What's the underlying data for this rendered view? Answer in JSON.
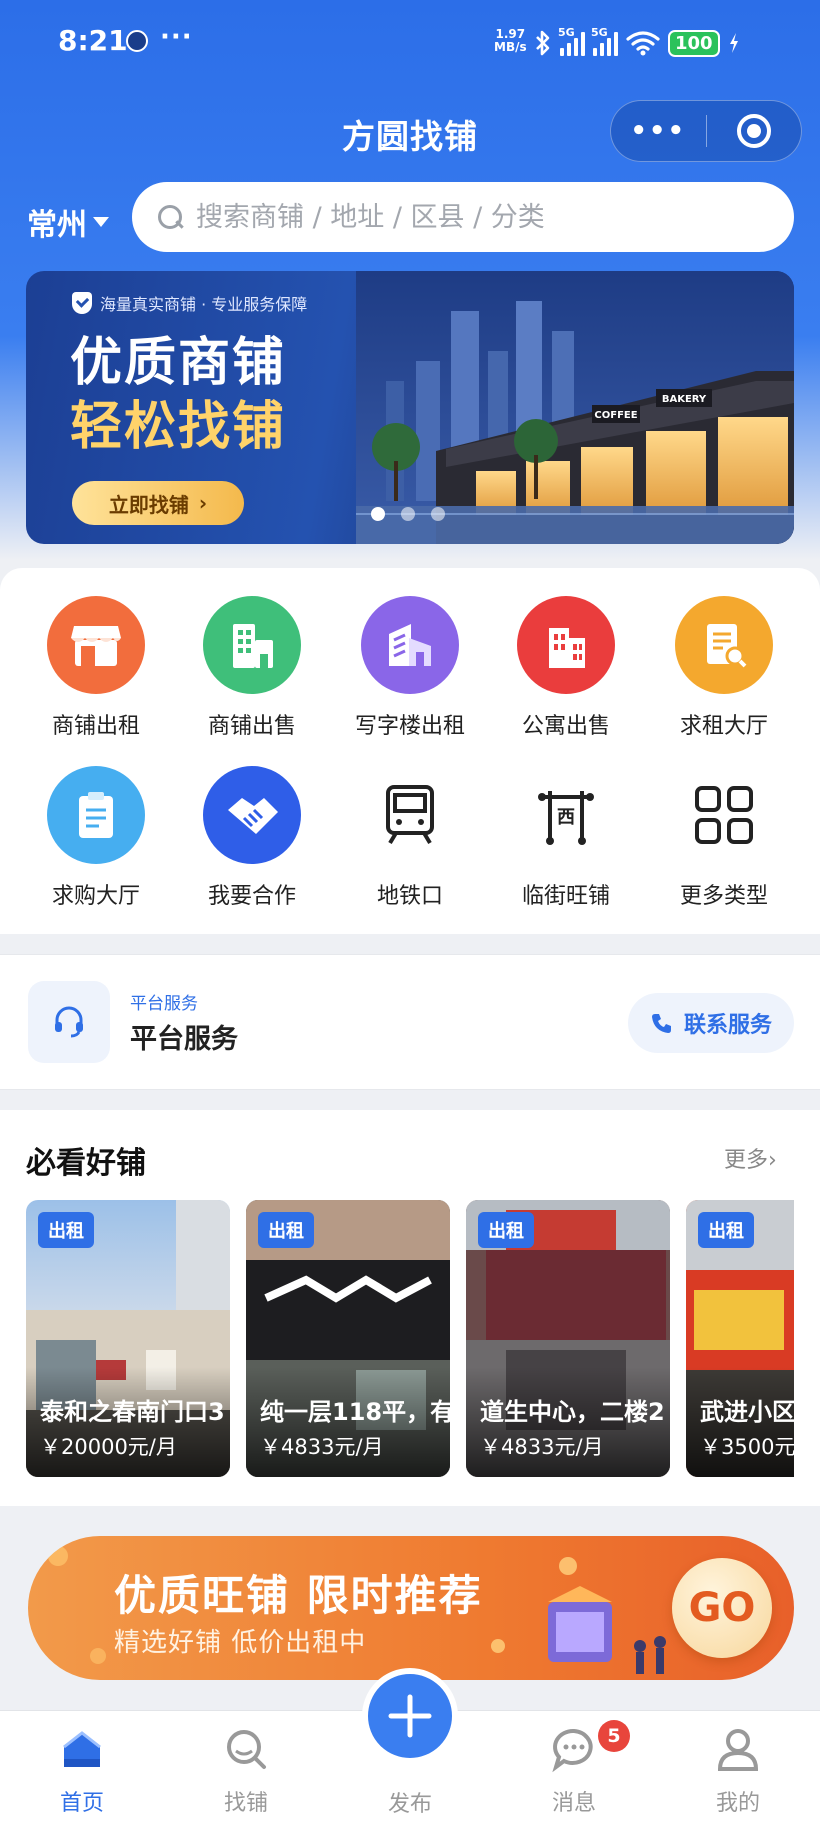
{
  "status_bar": {
    "time": "8:21",
    "more": "···",
    "speed_top": "1.97",
    "speed_bottom": "MB/s",
    "signal_tag_1": "5G",
    "signal_tag_2": "5G",
    "battery": "100"
  },
  "header": {
    "title": "方圆找铺",
    "capsule_more": "•••"
  },
  "search": {
    "city": "常州",
    "placeholder": "搜索商铺 / 地址 / 区县 / 分类"
  },
  "banner": {
    "tagline": "海量真实商铺 · 专业服务保障",
    "headline_1": "优质商铺",
    "headline_2": "轻松找铺",
    "button_label": "立即找铺",
    "button_arrow": "›",
    "slide_count": 3,
    "active_slide": 1,
    "storefront_sign_1": "COFFEE",
    "storefront_sign_2": "BAKERY"
  },
  "categories": [
    {
      "label": "商铺出租",
      "icon": "shop-icon",
      "color": "#f26d3d"
    },
    {
      "label": "商铺出售",
      "icon": "building-icon",
      "color": "#3fbf7a"
    },
    {
      "label": "写字楼出租",
      "icon": "office-icon",
      "color": "#8a66e8"
    },
    {
      "label": "公寓出售",
      "icon": "apartment-icon",
      "color": "#ea3d3d"
    },
    {
      "label": "求租大厅",
      "icon": "doc-search-icon",
      "color": "#f4a82e"
    },
    {
      "label": "求购大厅",
      "icon": "clipboard-icon",
      "color": "#46aef0"
    },
    {
      "label": "我要合作",
      "icon": "handshake-icon",
      "color": "#2f5ee8"
    },
    {
      "label": "地铁口",
      "icon": "subway-icon",
      "color": "#222222"
    },
    {
      "label": "临街旺铺",
      "icon": "street-shop-icon",
      "color": "#222222"
    },
    {
      "label": "更多类型",
      "icon": "grid-icon",
      "color": "#222222"
    }
  ],
  "service": {
    "small_label": "平台服务",
    "title": "平台服务",
    "button_label": "联系服务"
  },
  "hot": {
    "title": "必看好铺",
    "more": "更多",
    "more_arrow": "›",
    "items": [
      {
        "badge": "出租",
        "name": "泰和之春南门口3",
        "price": "￥20000元/月"
      },
      {
        "badge": "出租",
        "name": "纯一层118平，有",
        "price": "￥4833元/月"
      },
      {
        "badge": "出租",
        "name": "道生中心，二楼2",
        "price": "￥4833元/月"
      },
      {
        "badge": "出租",
        "name": "武进小区",
        "price": "￥3500元"
      }
    ]
  },
  "promo": {
    "headline": "优质旺铺 限时推荐",
    "subline": "精选好铺  低价出租中",
    "go": "GO"
  },
  "tabbar": {
    "home": "首页",
    "find": "找铺",
    "publish": "发布",
    "messages": "消息",
    "messages_badge": "5",
    "mine": "我的"
  },
  "colors": {
    "brand_blue": "#2f6fe6",
    "header_blue": "#2c6ee8",
    "promo_orange": "#ef7a30",
    "badge_red": "#e8453c"
  }
}
